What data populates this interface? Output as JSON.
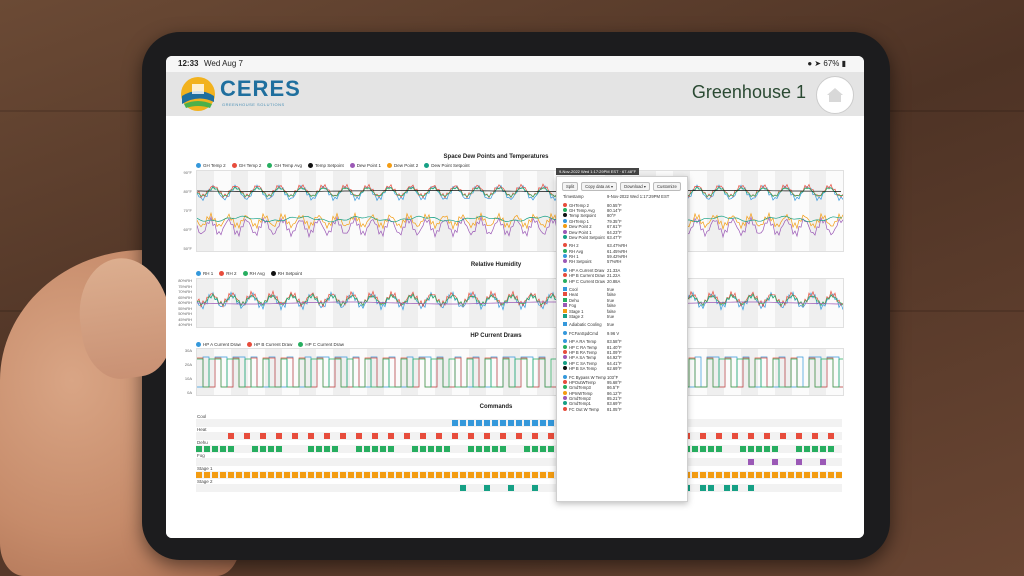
{
  "status_bar": {
    "time": "12:33",
    "date": "Wed Aug 7",
    "battery": "67%"
  },
  "header": {
    "logo_text": "CERES",
    "logo_sub": "GREENHOUSE SOLUTIONS",
    "title": "Greenhouse 1"
  },
  "section1": {
    "title": "Space Dew Points and Temperatures",
    "legend": [
      "GH Temp 2",
      "GH Temp 2",
      "GH Temp Avg",
      "Temp Setpoint",
      "Dew Point 1",
      "Dew Point 2",
      "Dew Point Setpoint"
    ],
    "yticks": [
      "90°F",
      "80°F",
      "70°F",
      "60°F",
      "50°F"
    ]
  },
  "section2": {
    "title": "Relative Humidity",
    "legend": [
      "RH 1",
      "RH 2",
      "RH Avg",
      "RH Setpoint"
    ],
    "yticks": [
      "80%RH",
      "75%RH",
      "70%RH",
      "65%RH",
      "60%RH",
      "55%RH",
      "50%RH",
      "45%RH",
      "40%RH"
    ]
  },
  "section3": {
    "title": "HP Current Draws",
    "legend": [
      "HP A Current Draw",
      "HP B Current Draw",
      "HP C Current Draw"
    ],
    "yticks": [
      "30A",
      "20A",
      "10A",
      "0A"
    ]
  },
  "section4": {
    "title": "Commands",
    "rows": [
      "Cool",
      "Heat",
      "Dehu",
      "Fog",
      "Stage 1",
      "Stage 2"
    ]
  },
  "tooltip": {
    "header": "9-Nov-2022 Wed 1:17:29PM EST · 67.48°F",
    "buttons": [
      "Split",
      "Copy data as ▾",
      "Download ▾",
      "Customize"
    ],
    "timestamp_label": "Timestamp",
    "timestamp_value": "9-Nov-2022 Wed 1:17:29PM EST",
    "groups": [
      [
        {
          "name": "GHTemp 2",
          "value": "80.55°F",
          "color": "#e74c3c"
        },
        {
          "name": "GH Temp Avg",
          "value": "80.14°F",
          "color": "#27ae60"
        },
        {
          "name": "Temp Setpoint",
          "value": "80°F",
          "color": "#111111"
        },
        {
          "name": "GHTemp 1",
          "value": "79.35°F",
          "color": "#3498db"
        },
        {
          "name": "Dew Point 2",
          "value": "67.61°F",
          "color": "#f39c12"
        },
        {
          "name": "Dew Point 1",
          "value": "64.23°F",
          "color": "#9b59b6"
        },
        {
          "name": "Dew Point Setpoint",
          "value": "63.47°F",
          "color": "#16a085"
        }
      ],
      [
        {
          "name": "RH 2",
          "value": "63.47%RH",
          "color": "#e74c3c"
        },
        {
          "name": "RH Avg",
          "value": "61.45%RH",
          "color": "#27ae60"
        },
        {
          "name": "RH 1",
          "value": "59.42%RH",
          "color": "#3498db"
        },
        {
          "name": "RH Setpoint",
          "value": "57%RH",
          "color": "#9b59b6"
        }
      ],
      [
        {
          "name": "HP A Current Draw",
          "value": "21.33A",
          "color": "#3498db"
        },
        {
          "name": "HP B Current Draw",
          "value": "21.22A",
          "color": "#e74c3c"
        },
        {
          "name": "HP C Current Draw",
          "value": "20.88A",
          "color": "#27ae60"
        }
      ],
      [
        {
          "name": "Cool",
          "value": "true",
          "color": "#3498db",
          "square": true
        },
        {
          "name": "Heat",
          "value": "false",
          "color": "#e74c3c",
          "square": true
        },
        {
          "name": "Dehu",
          "value": "true",
          "color": "#27ae60",
          "square": true
        },
        {
          "name": "Fog",
          "value": "false",
          "color": "#9b59b6",
          "square": true
        },
        {
          "name": "Stage 1",
          "value": "false",
          "color": "#f39c12",
          "square": true
        },
        {
          "name": "Stage 2",
          "value": "true",
          "color": "#16a085",
          "square": true
        }
      ],
      [
        {
          "name": "Adiabatic Cooling",
          "value": "true",
          "color": "#3498db",
          "square": true
        }
      ],
      [
        {
          "name": "FCFanSpdCmd",
          "value": "9.96 V",
          "color": "#3498db"
        }
      ],
      [
        {
          "name": "HP A RA Temp",
          "value": "83.58°F",
          "color": "#3498db"
        },
        {
          "name": "HP C RA Temp",
          "value": "81.40°F",
          "color": "#27ae60"
        },
        {
          "name": "HP B RA Temp",
          "value": "81.09°F",
          "color": "#e74c3c"
        },
        {
          "name": "HP A SA Temp",
          "value": "64.92°F",
          "color": "#9b59b6"
        },
        {
          "name": "HP C SA Temp",
          "value": "64.41°F",
          "color": "#16a085"
        },
        {
          "name": "HP B SA Temp",
          "value": "62.69°F",
          "color": "#111111"
        }
      ],
      [
        {
          "name": "FC Bypass W Temp",
          "value": "103°F",
          "color": "#3498db"
        },
        {
          "name": "HPOutWTemp",
          "value": "95.68°F",
          "color": "#e74c3c"
        },
        {
          "name": "GrndTemp3",
          "value": "86.5°F",
          "color": "#27ae60"
        },
        {
          "name": "HPInWTemp",
          "value": "86.12°F",
          "color": "#f39c12"
        },
        {
          "name": "GrndTemp2",
          "value": "85.21°F",
          "color": "#9b59b6"
        },
        {
          "name": "GrndTemp1",
          "value": "83.69°F",
          "color": "#16a085"
        },
        {
          "name": "FC Out W Temp",
          "value": "81.05°F",
          "color": "#e74c3c"
        }
      ]
    ]
  },
  "colors": {
    "blue": "#3498db",
    "red": "#e74c3c",
    "green": "#27ae60",
    "black": "#111111",
    "purple": "#9b59b6",
    "orange": "#f39c12",
    "teal": "#16a085",
    "header_bg": "#e4e4e4"
  }
}
